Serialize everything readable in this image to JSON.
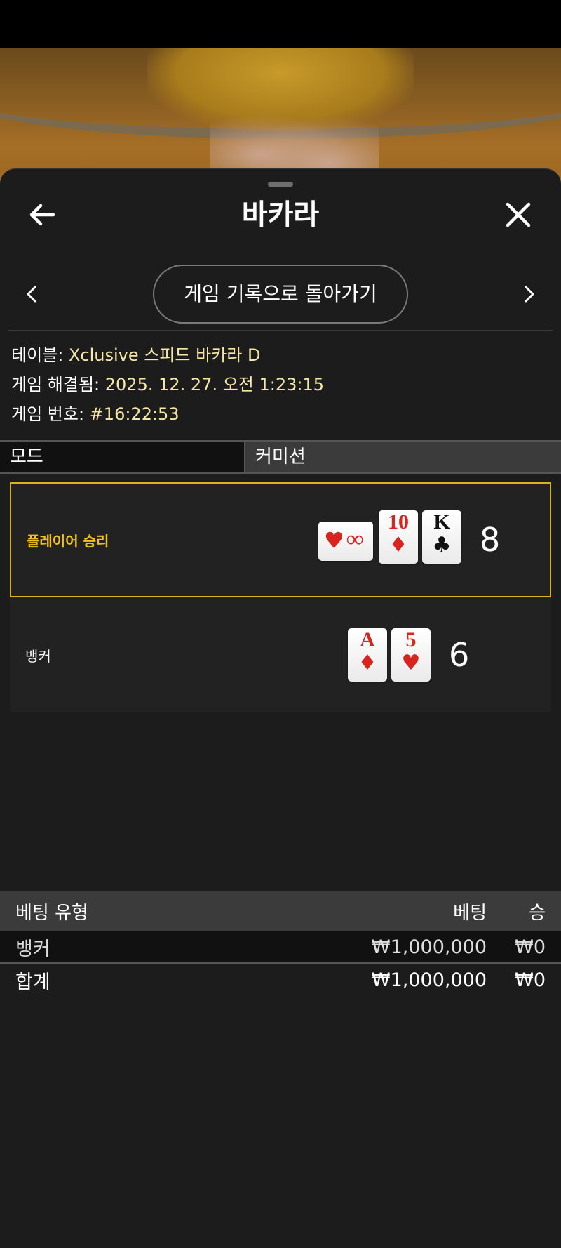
{
  "header": {
    "title": "바카라"
  },
  "nav": {
    "return_label": "게임 기록으로 돌아가기"
  },
  "info": {
    "table_label": "테이블:",
    "table_value": "Xclusive 스피드 바카라 D",
    "resolved_label": "게임 해결됨:",
    "resolved_value": "2025. 12. 27. 오전 1:23:15",
    "number_label": "게임 번호:",
    "number_value": "#16:22:53"
  },
  "tabs": {
    "mode": "모드",
    "commission": "커미션"
  },
  "results": {
    "player": {
      "label": "플레이어 승리",
      "score": "8",
      "cards": [
        {
          "rank": "∞",
          "suit": "♥",
          "color": "red",
          "orientation": "sideways"
        },
        {
          "rank": "10",
          "suit": "♦",
          "color": "red"
        },
        {
          "rank": "K",
          "suit": "♣",
          "color": "black"
        }
      ]
    },
    "banker": {
      "label": "뱅커",
      "score": "6",
      "cards": [
        {
          "rank": "A",
          "suit": "♦",
          "color": "red"
        },
        {
          "rank": "5",
          "suit": "♥",
          "color": "red"
        }
      ]
    }
  },
  "bets": {
    "headers": {
      "type": "베팅 유형",
      "bet": "베팅",
      "win": "승"
    },
    "rows": [
      {
        "type": "뱅커",
        "bet": "₩1,000,000",
        "win": "₩0"
      }
    ],
    "total": {
      "type": "합계",
      "bet": "₩1,000,000",
      "win": "₩0"
    }
  },
  "colors": {
    "highlight": "#d9b21f",
    "info_value": "#f6e7a6",
    "sheet_bg": "#1c1c1c"
  }
}
